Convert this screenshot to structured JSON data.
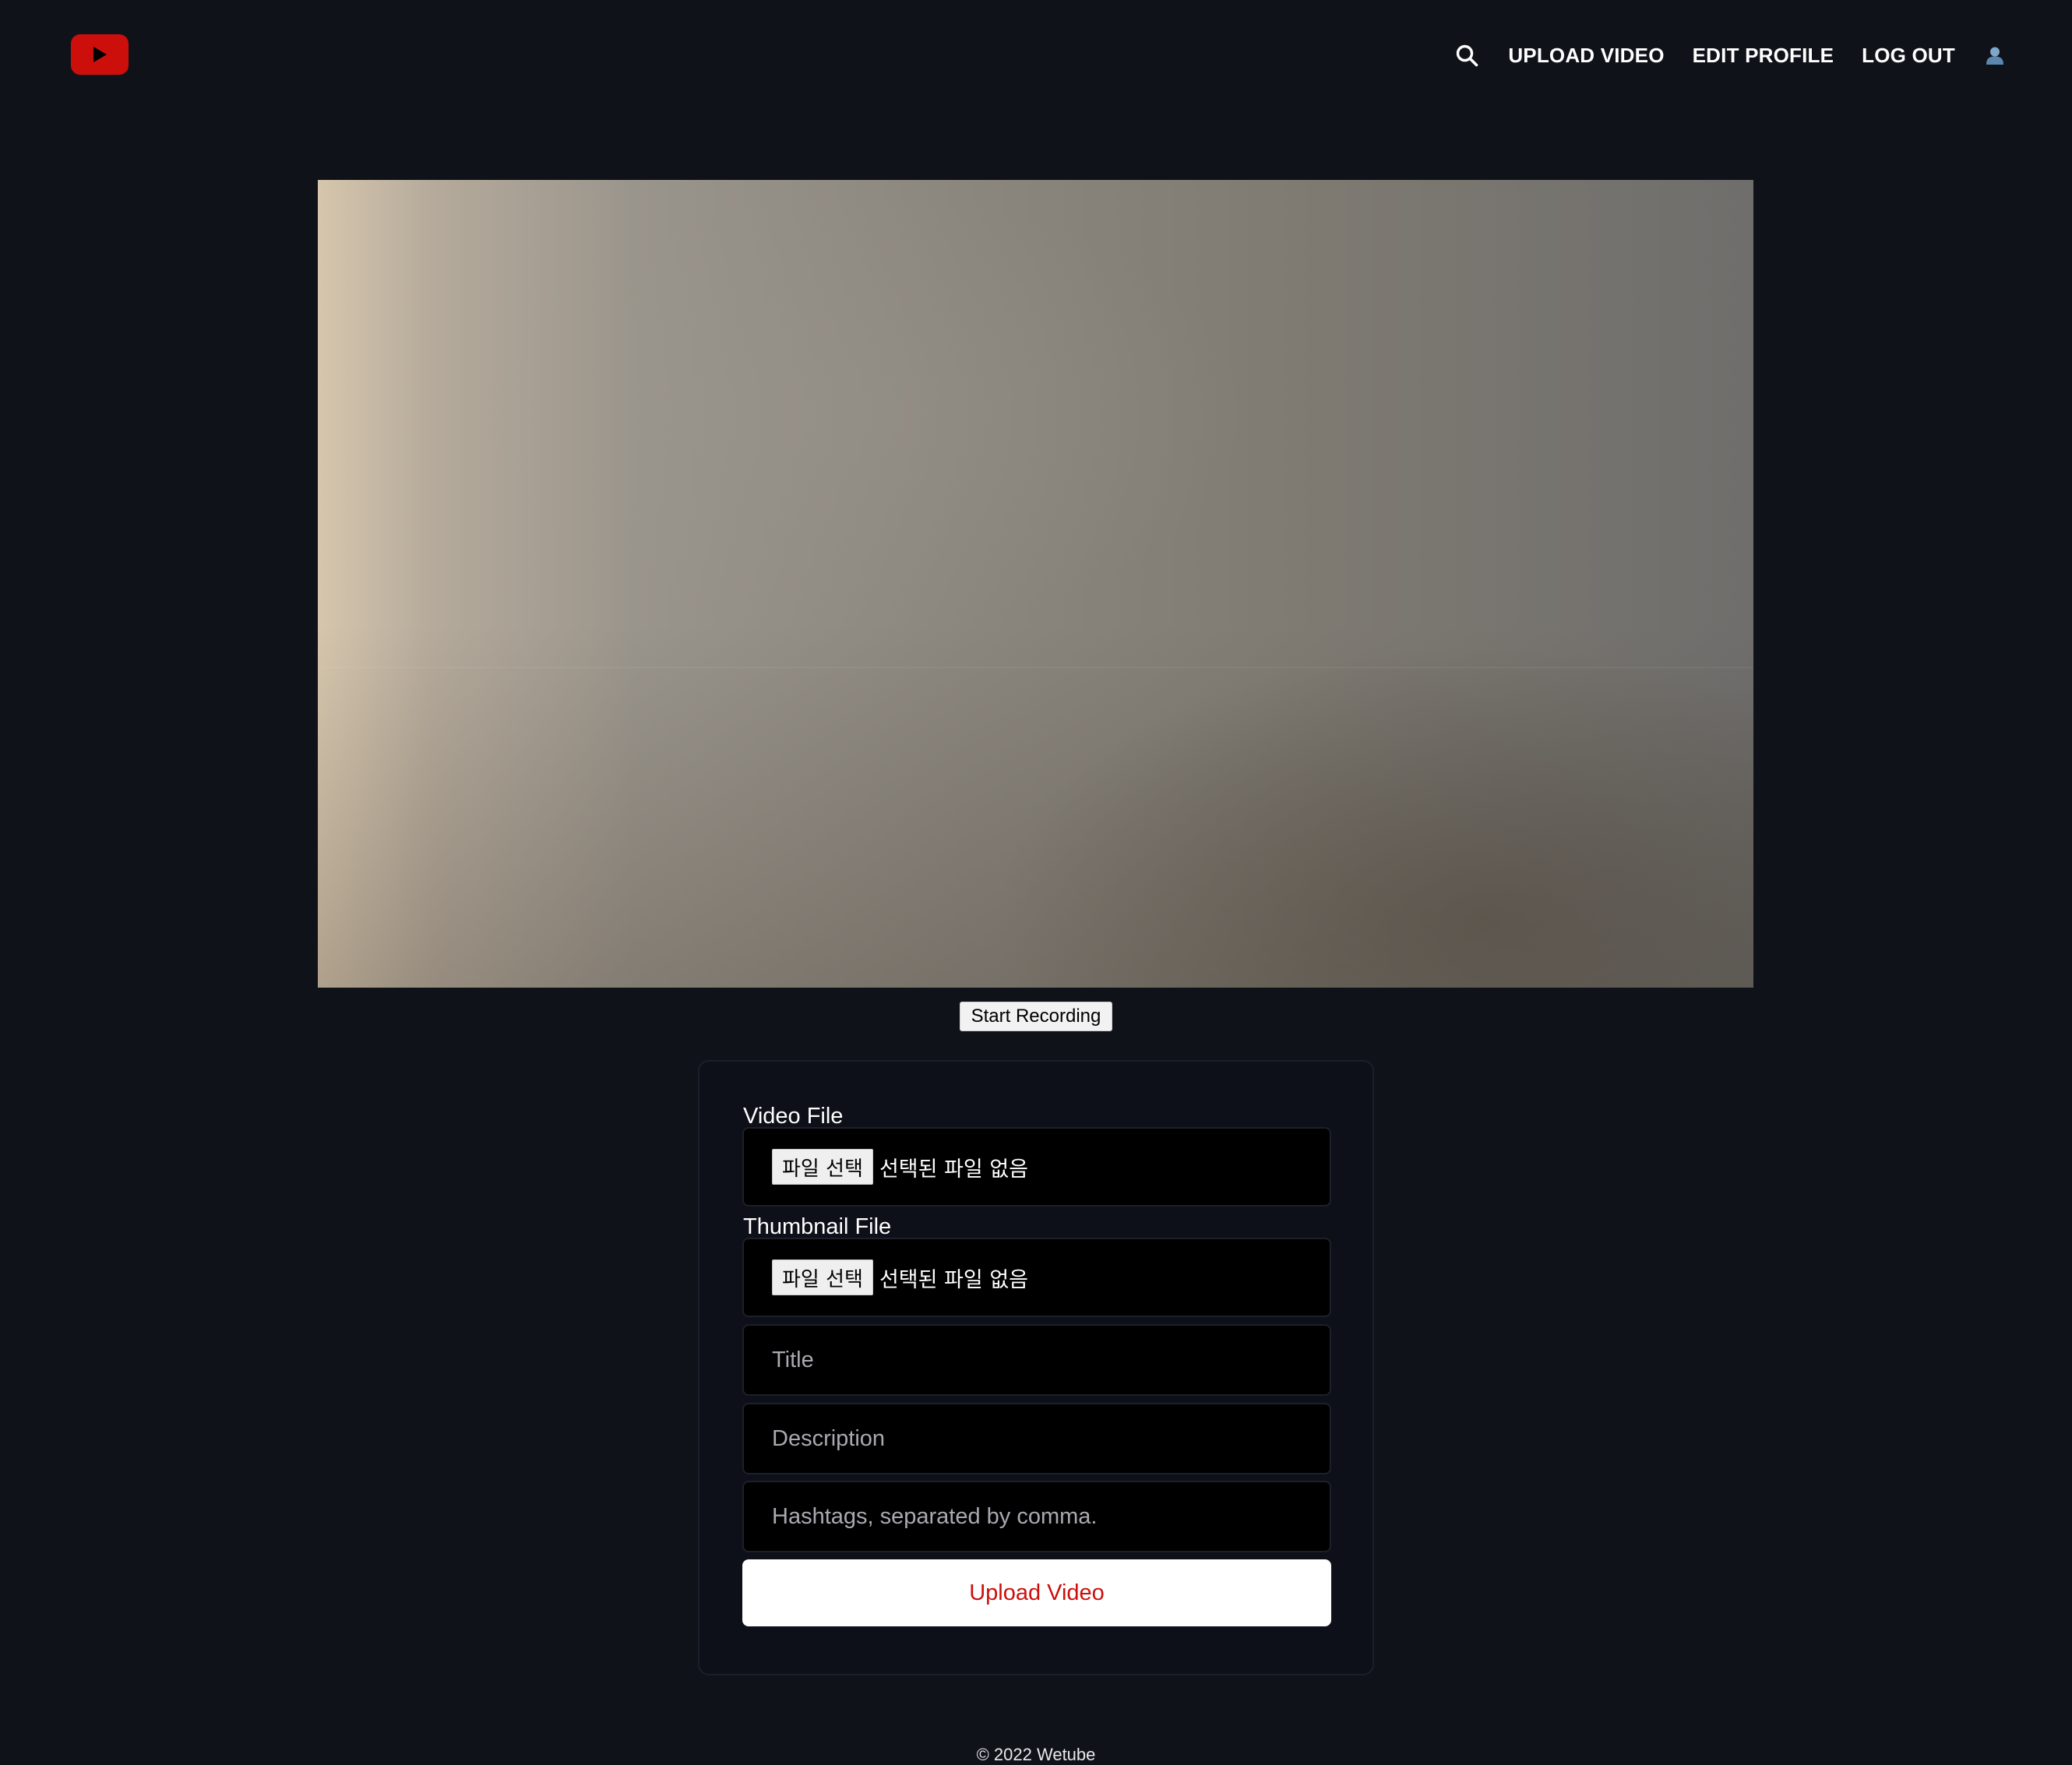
{
  "header": {
    "logo_icon": "youtube-play-icon",
    "search_icon": "search-icon",
    "nav": {
      "upload_video": "UPLOAD VIDEO",
      "edit_profile": "EDIT PROFILE",
      "log_out": "LOG OUT"
    },
    "avatar_icon": "user-avatar-icon"
  },
  "recorder": {
    "start_recording_label": "Start Recording"
  },
  "form": {
    "video_file": {
      "label": "Video File",
      "button_label": "파일 선택",
      "status": "선택된 파일 없음"
    },
    "thumbnail_file": {
      "label": "Thumbnail File",
      "button_label": "파일 선택",
      "status": "선택된 파일 없음"
    },
    "title": {
      "value": "",
      "placeholder": "Title"
    },
    "description": {
      "value": "",
      "placeholder": "Description"
    },
    "hashtags": {
      "value": "",
      "placeholder": "Hashtags, separated by comma."
    },
    "submit_label": "Upload Video"
  },
  "footer": {
    "text": "© 2022 Wetube"
  },
  "colors": {
    "background": "#10121a",
    "brand_red": "#cc0f0b",
    "input_background": "#000000",
    "button_background": "#ffffff"
  }
}
